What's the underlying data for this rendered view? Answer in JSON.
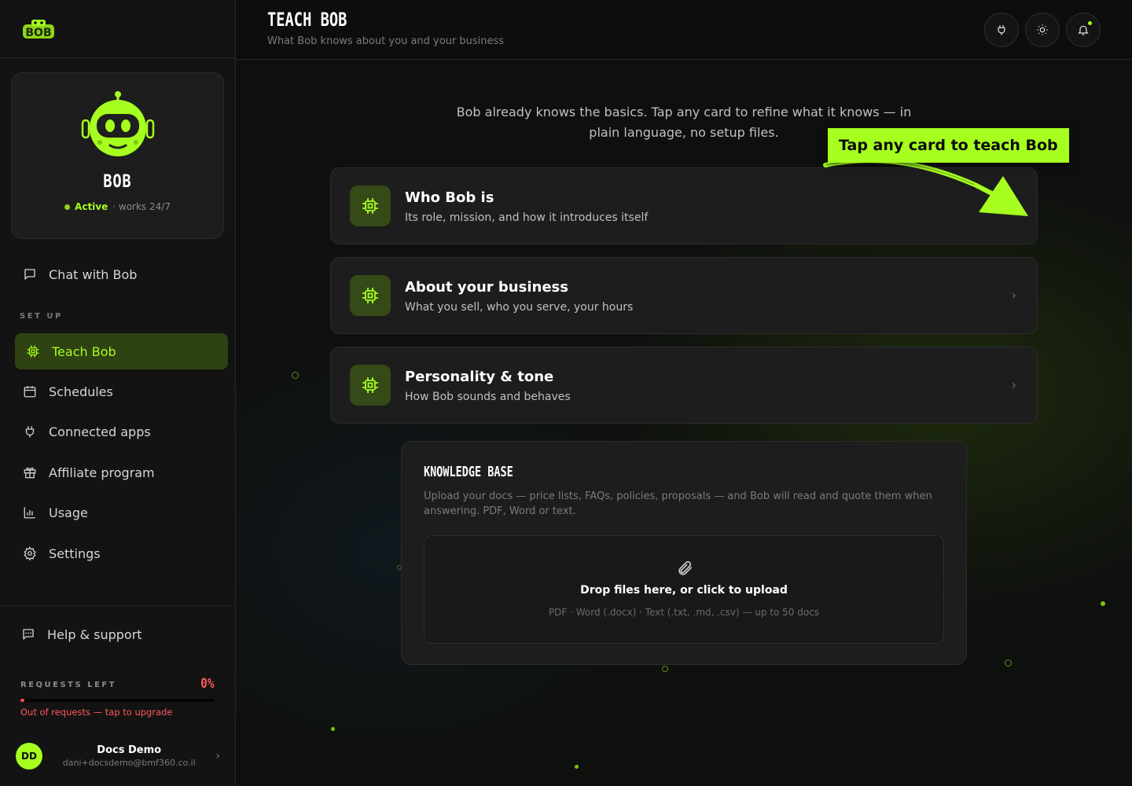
{
  "sidebar": {
    "bob": {
      "name": "BOB",
      "status": "Active",
      "hours": "· works 24/7"
    },
    "chat_label": "Chat with Bob",
    "section_setup": "SET UP",
    "items": [
      {
        "label": "Teach Bob",
        "icon": "chip-icon",
        "active": true
      },
      {
        "label": "Schedules",
        "icon": "calendar-icon"
      },
      {
        "label": "Connected apps",
        "icon": "plug-icon"
      },
      {
        "label": "Affiliate program",
        "icon": "gift-icon"
      },
      {
        "label": "Usage",
        "icon": "bar-chart-icon"
      },
      {
        "label": "Settings",
        "icon": "gear-icon"
      }
    ],
    "help_label": "Help & support",
    "requests": {
      "label": "REQUESTS LEFT",
      "percent": "0%",
      "progress": 0.0,
      "message": "Out of requests — tap to upgrade"
    },
    "user": {
      "initials": "DD",
      "name": "Docs Demo",
      "email": "dani+docsdemo@bmf360.co.il"
    }
  },
  "header": {
    "title": "TEACH BOB",
    "subtitle": "What Bob knows about you and your business"
  },
  "main": {
    "intro": "Bob already knows the basics. Tap any card to refine what it knows — in plain language, no setup files.",
    "callout": "Tap any card to teach Bob",
    "cards": [
      {
        "title": "Who Bob is",
        "description": "Its role, mission, and how it introduces itself"
      },
      {
        "title": "About your business",
        "description": "What you sell, who you serve, your hours"
      },
      {
        "title": "Personality & tone",
        "description": "How Bob sounds and behaves"
      }
    ],
    "knowledge_base": {
      "title": "KNOWLEDGE BASE",
      "description": "Upload your docs — price lists, FAQs, policies, proposals — and Bob will read and quote them when answering. PDF, Word or text.",
      "drop_title": "Drop files here, or click to upload",
      "drop_sub": "PDF · Word (.docx) · Text (.txt, .md, .csv) — up to 50 docs"
    }
  },
  "colors": {
    "accent": "#a6ff1e",
    "danger": "#ff5a5a",
    "active_bg": "#2f4212"
  }
}
